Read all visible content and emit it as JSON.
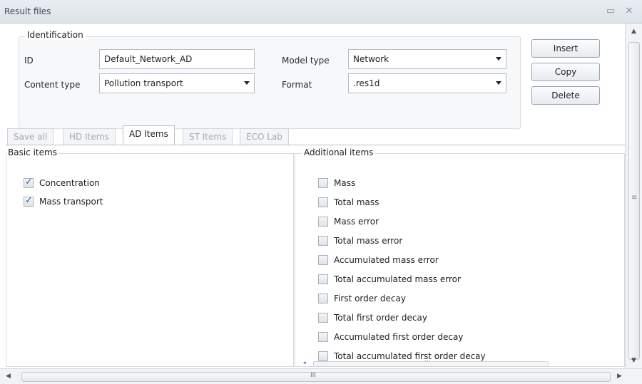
{
  "window": {
    "title": "Result files",
    "restore_icon": "restore-icon",
    "close_icon": "close-icon"
  },
  "identification": {
    "legend": "Identification",
    "id_label": "ID",
    "id_value": "Default_Network_AD",
    "content_type_label": "Content type",
    "content_type_value": "Pollution transport",
    "model_type_label": "Model type",
    "model_type_value": "Network",
    "format_label": "Format",
    "format_value": ".res1d"
  },
  "buttons": {
    "insert": "Insert",
    "copy": "Copy",
    "delete": "Delete"
  },
  "tabs": [
    {
      "label": "Save all",
      "active": false
    },
    {
      "label": "HD Items",
      "active": false
    },
    {
      "label": "AD Items",
      "active": true
    },
    {
      "label": "ST Items",
      "active": false
    },
    {
      "label": "ECO Lab",
      "active": false
    }
  ],
  "basic_items": {
    "legend": "Basic items",
    "items": [
      {
        "label": "Concentration",
        "checked": true
      },
      {
        "label": "Mass transport",
        "checked": true
      }
    ]
  },
  "additional_items": {
    "legend": "Additional items",
    "items": [
      {
        "label": "Mass",
        "checked": false
      },
      {
        "label": "Total mass",
        "checked": false
      },
      {
        "label": "Mass error",
        "checked": false
      },
      {
        "label": "Total mass error",
        "checked": false
      },
      {
        "label": "Accumulated mass error",
        "checked": false
      },
      {
        "label": "Total accumulated mass error",
        "checked": false
      },
      {
        "label": "First order decay",
        "checked": false
      },
      {
        "label": "Total first order decay",
        "checked": false
      },
      {
        "label": "Accumulated first order decay",
        "checked": false
      },
      {
        "label": "Total accumulated first order decay",
        "checked": false
      }
    ]
  },
  "scroll_grip": "III",
  "inner_scroll_grip": "..."
}
